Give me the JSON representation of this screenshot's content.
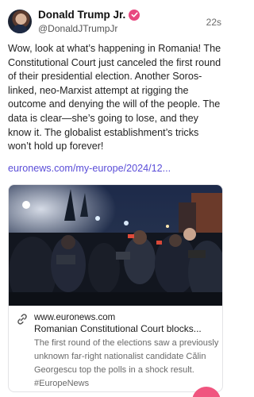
{
  "author": {
    "name": "Donald Trump Jr.",
    "handle": "@DonaldJTrumpJr",
    "verified": true
  },
  "post": {
    "timestamp": "22s",
    "text": "Wow, look at what’s happening in Romania! The Constitutional Court just canceled the first round of their presidential election. Another Soros-linked, neo-Marxist attempt at rigging the outcome and denying the will of the people. The data is clear—she’s going to lose, and they know it. The globalist establishment’s tricks won’t hold up forever!",
    "link_text": "euronews.com/my-europe/2024/12..."
  },
  "link_card": {
    "domain": "www.euronews.com",
    "title": "Romanian Constitutional Court blocks...",
    "description": "The first round of the elections saw a previously unknown far-right nationalist candidate Călin Georgescu top the polls in a shock result. #EuropeNews",
    "image_icon": "press-crowd-photo"
  },
  "colors": {
    "accent": "#5b4ed8",
    "verified": "#e8477f",
    "fab": "#f0557f"
  }
}
